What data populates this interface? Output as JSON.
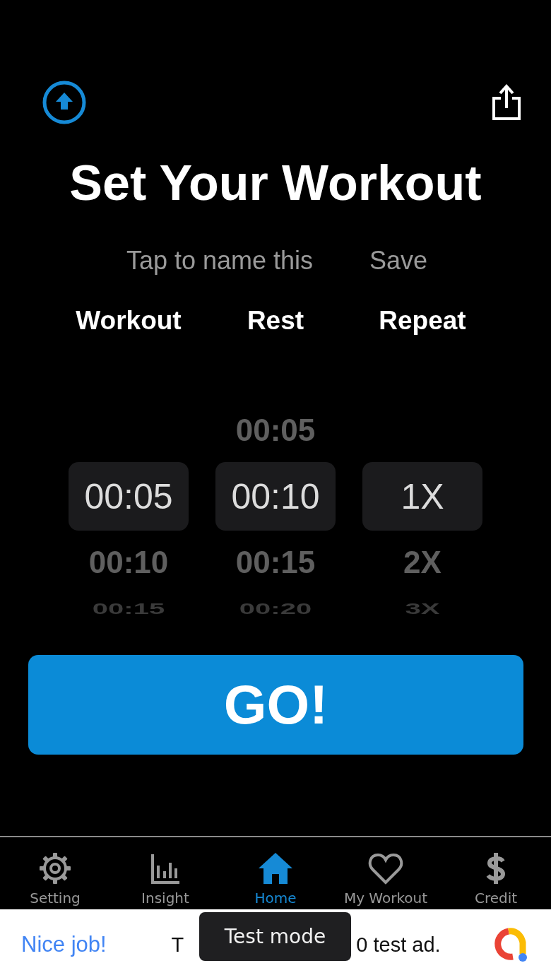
{
  "title": "Set Your Workout",
  "name_prompt": "Tap to name this",
  "save_label": "Save",
  "pickers": [
    {
      "header": "Workout",
      "items": [
        {
          "text": "00:05",
          "selected": true
        },
        {
          "text": "00:10",
          "selected": false
        },
        {
          "text": "00:15",
          "selected": false
        }
      ]
    },
    {
      "header": "Rest",
      "items": [
        {
          "text": "00:05",
          "selected": false
        },
        {
          "text": "00:10",
          "selected": true
        },
        {
          "text": "00:15",
          "selected": false
        },
        {
          "text": "00:20",
          "selected": false
        }
      ]
    },
    {
      "header": "Repeat",
      "items": [
        {
          "text": "1X",
          "selected": true
        },
        {
          "text": "2X",
          "selected": false
        },
        {
          "text": "3X",
          "selected": false
        }
      ]
    }
  ],
  "go_label": "GO!",
  "tabs": [
    {
      "label": "Setting",
      "selected": false
    },
    {
      "label": "Insight",
      "selected": false
    },
    {
      "label": "Home",
      "selected": true
    },
    {
      "label": "My Workout",
      "selected": false
    },
    {
      "label": "Credit",
      "selected": false
    }
  ],
  "ad": {
    "headline": "Nice job!",
    "text_start": "T",
    "tooltip": "Test mode",
    "text_end": "0 test ad."
  }
}
